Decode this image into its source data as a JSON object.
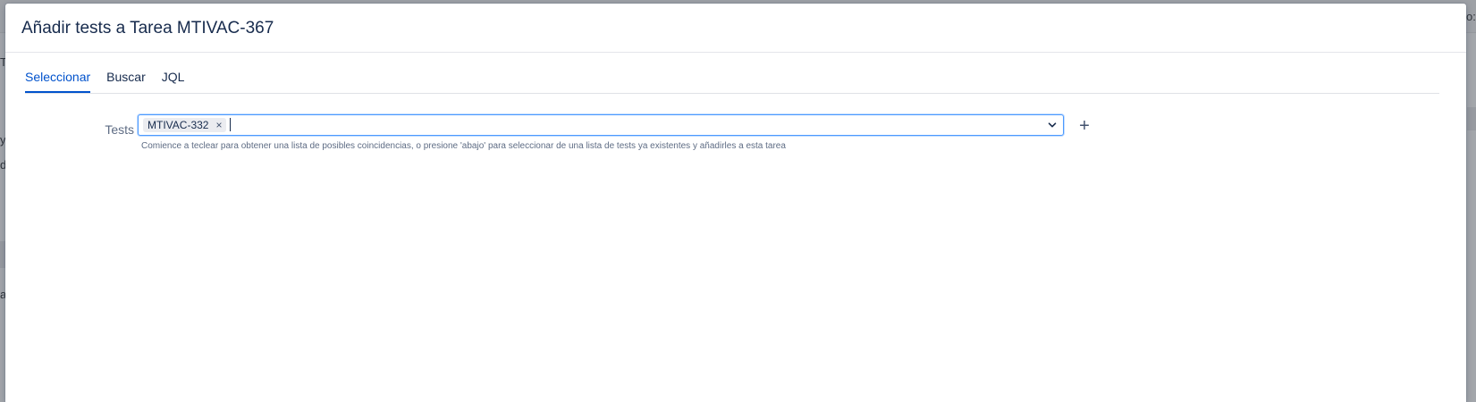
{
  "background": {
    "fragments": [
      "o:",
      "T",
      "y",
      "di",
      "a"
    ]
  },
  "modal": {
    "title": "Añadir tests a Tarea MTIVAC-367"
  },
  "tabs": [
    {
      "label": "Seleccionar",
      "active": true
    },
    {
      "label": "Buscar",
      "active": false
    },
    {
      "label": "JQL",
      "active": false
    }
  ],
  "form": {
    "tests_label": "Tests",
    "selected": [
      {
        "label": "MTIVAC-332",
        "remove": "×"
      }
    ],
    "input_value": "",
    "add_label": "+",
    "help": "Comience a teclear para obtener una lista de posibles coincidencias, o presione 'abajo' para seleccionar de una lista de tests ya existentes y añadirles a esta tarea"
  },
  "icons": {
    "dropdown": "chevron-down-icon",
    "add": "plus-icon",
    "remove": "close-icon"
  },
  "colors": {
    "accent": "#0052cc",
    "focus_border": "#4c9aff",
    "text": "#172b4d",
    "muted": "#5e6c84"
  }
}
